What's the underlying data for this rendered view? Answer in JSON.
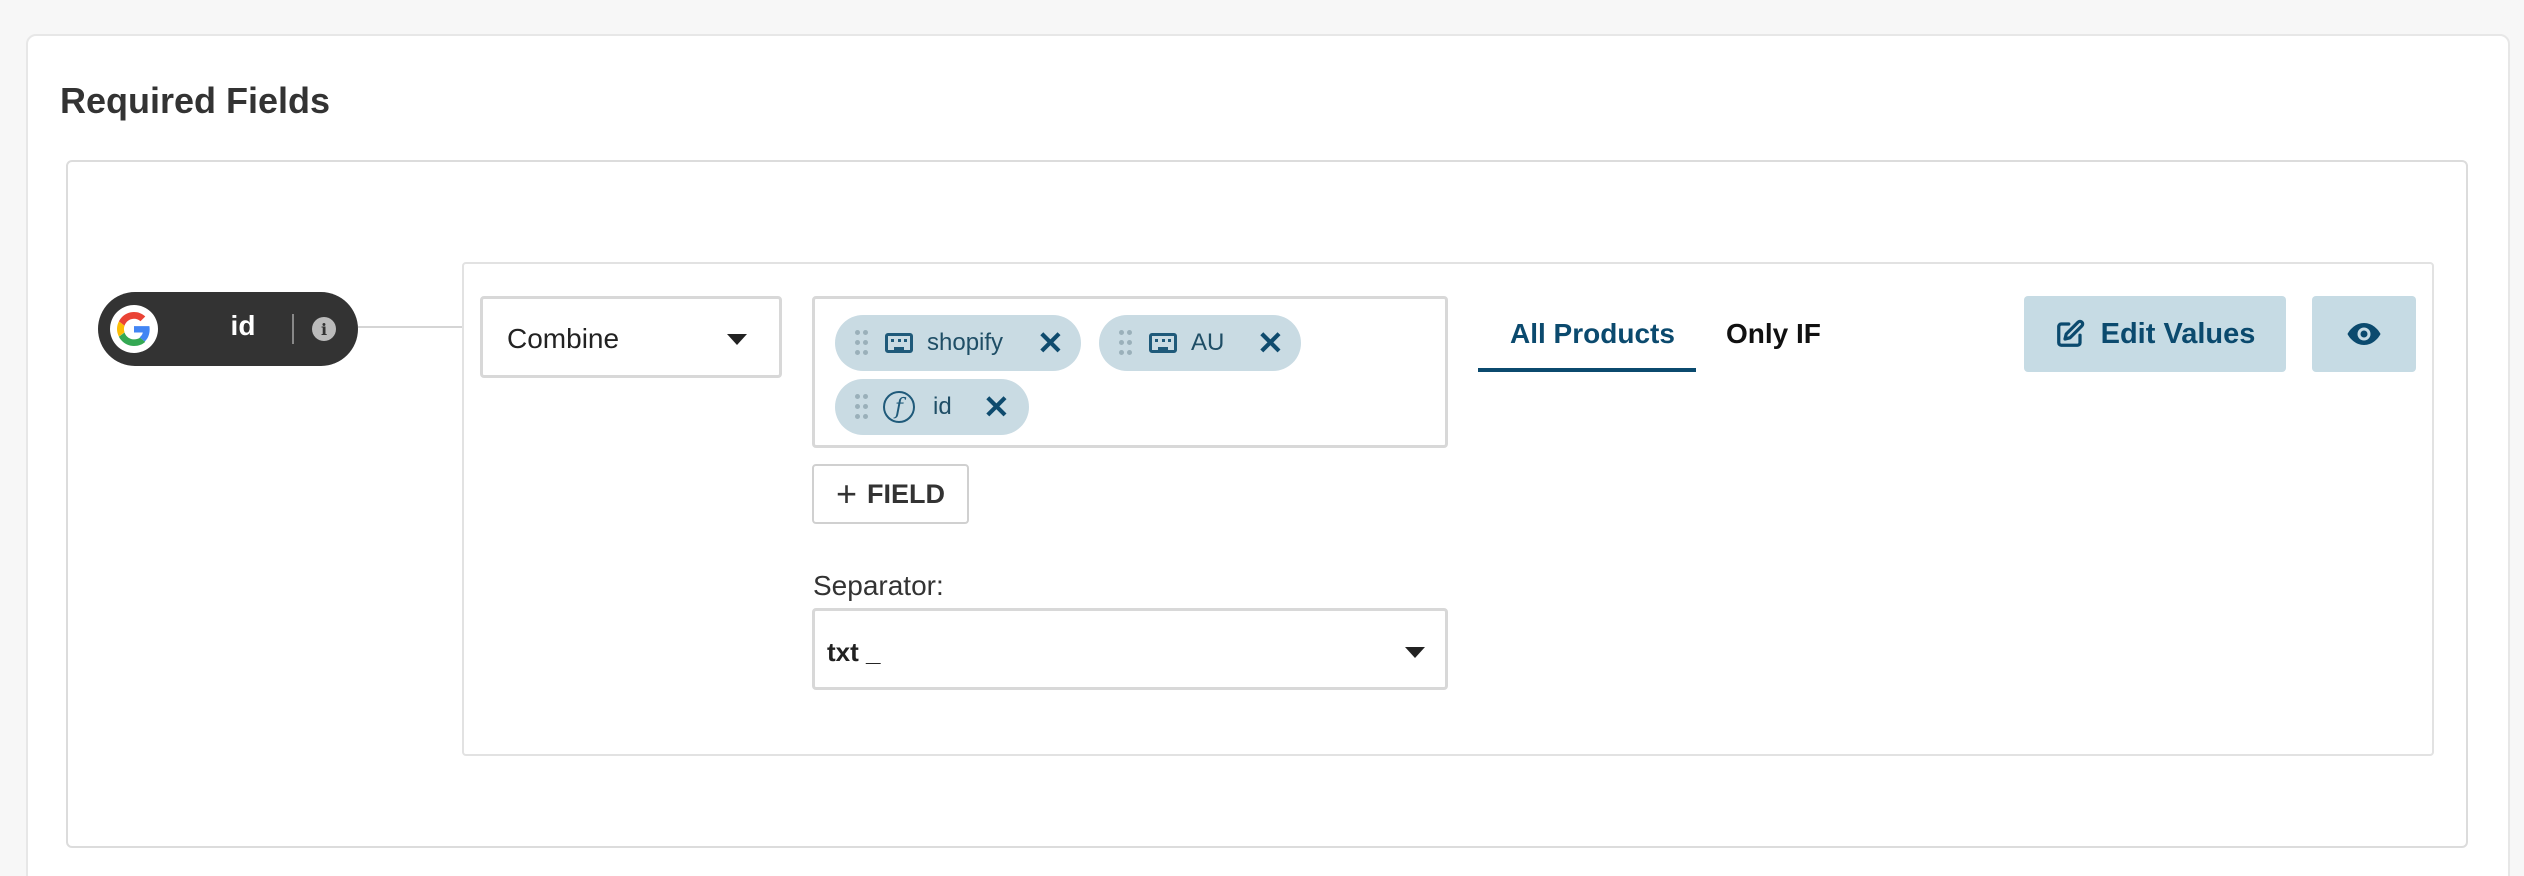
{
  "section": {
    "title": "Required Fields"
  },
  "field_pill": {
    "label": "id",
    "logo_icon": "google-icon",
    "info_icon": "info-icon"
  },
  "operation": {
    "selected": "Combine"
  },
  "chips": [
    {
      "icon": "keyboard-icon",
      "label": "shopify"
    },
    {
      "icon": "keyboard-icon",
      "label": "AU"
    },
    {
      "icon": "function-icon",
      "label": "id"
    }
  ],
  "add_field": {
    "label": "FIELD"
  },
  "separator": {
    "label": "Separator:",
    "selected": "txt _"
  },
  "tabs": [
    {
      "label": "All Products",
      "active": true
    },
    {
      "label": "Only IF",
      "active": false
    }
  ],
  "actions": {
    "edit_label": "Edit Values",
    "preview_icon": "eye-icon"
  },
  "colors": {
    "accent": "#0b4a6e",
    "chip_bg": "#c9dbe3",
    "button_bg": "#c6dbe4"
  }
}
